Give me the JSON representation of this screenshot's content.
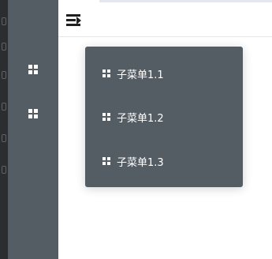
{
  "sidebar": {
    "items": [
      {
        "icon": "grid-icon"
      },
      {
        "icon": "grid-icon"
      }
    ]
  },
  "header": {
    "toggle_icon": "menu-fold-icon"
  },
  "submenu": {
    "items": [
      {
        "label": "子菜单1.1",
        "icon": "grid-icon"
      },
      {
        "label": "子菜单1.2",
        "icon": "grid-icon"
      },
      {
        "label": "子菜单1.3",
        "icon": "grid-icon"
      }
    ]
  },
  "colors": {
    "sidebar_bg": "#545c64",
    "menu_text": "#ffffff",
    "editor_bg": "#2b2d30"
  }
}
